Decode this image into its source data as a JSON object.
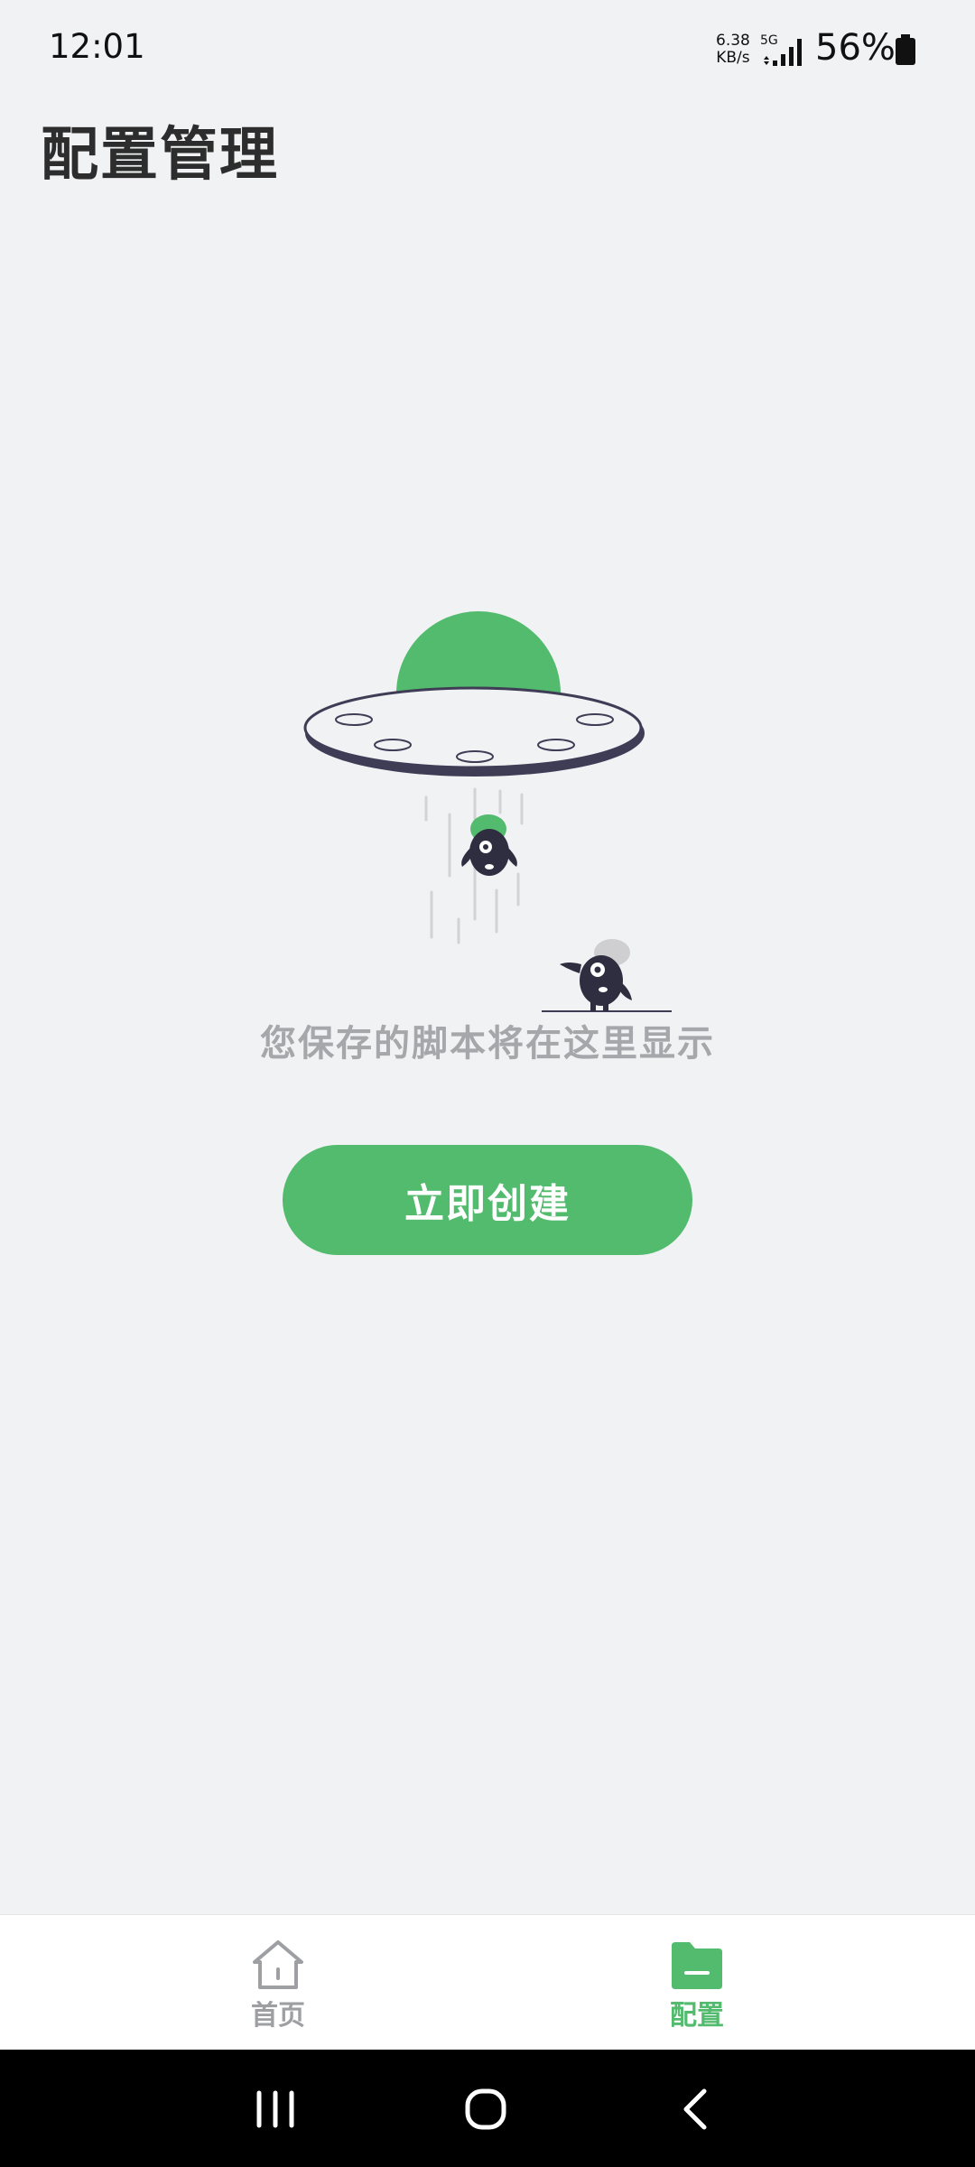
{
  "status_bar": {
    "time": "12:01",
    "net_speed_value": "6.38",
    "net_speed_unit": "KB/s",
    "network": "5G",
    "battery": "56%"
  },
  "page": {
    "title": "配置管理"
  },
  "empty_state": {
    "message": "您保存的脚本将在这里显示",
    "button_label": "立即创建"
  },
  "bottom_nav": {
    "items": [
      {
        "label": "首页",
        "icon": "home-icon",
        "active": false
      },
      {
        "label": "配置",
        "icon": "folder-icon",
        "active": true
      }
    ]
  },
  "system_nav": {
    "buttons": [
      "recent-apps-icon",
      "home-circle-icon",
      "back-icon"
    ]
  },
  "colors": {
    "accent": "#52BB6E",
    "background": "#F1F2F4",
    "text_dark": "#2D2D2D",
    "text_muted": "#A6A7AB",
    "ufo_dark": "#3F3D56"
  }
}
